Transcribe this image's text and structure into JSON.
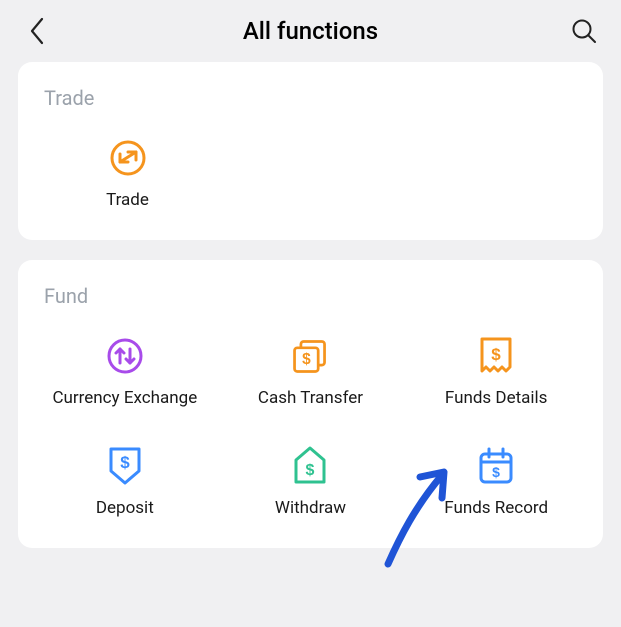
{
  "header": {
    "title": "All functions"
  },
  "sections": {
    "trade": {
      "title": "Trade",
      "items": [
        {
          "name": "trade",
          "label": "Trade"
        }
      ]
    },
    "fund": {
      "title": "Fund",
      "items": [
        {
          "name": "currency-exchange",
          "label": "Currency Exchange"
        },
        {
          "name": "cash-transfer",
          "label": "Cash Transfer"
        },
        {
          "name": "funds-details",
          "label": "Funds Details"
        },
        {
          "name": "deposit",
          "label": "Deposit"
        },
        {
          "name": "withdraw",
          "label": "Withdraw"
        },
        {
          "name": "funds-record",
          "label": "Funds Record"
        }
      ]
    }
  },
  "colors": {
    "orange": "#f5941d",
    "purple": "#a84bea",
    "teal": "#2fc290",
    "blue": "#3a8bff",
    "arrow": "#1f54d6"
  }
}
